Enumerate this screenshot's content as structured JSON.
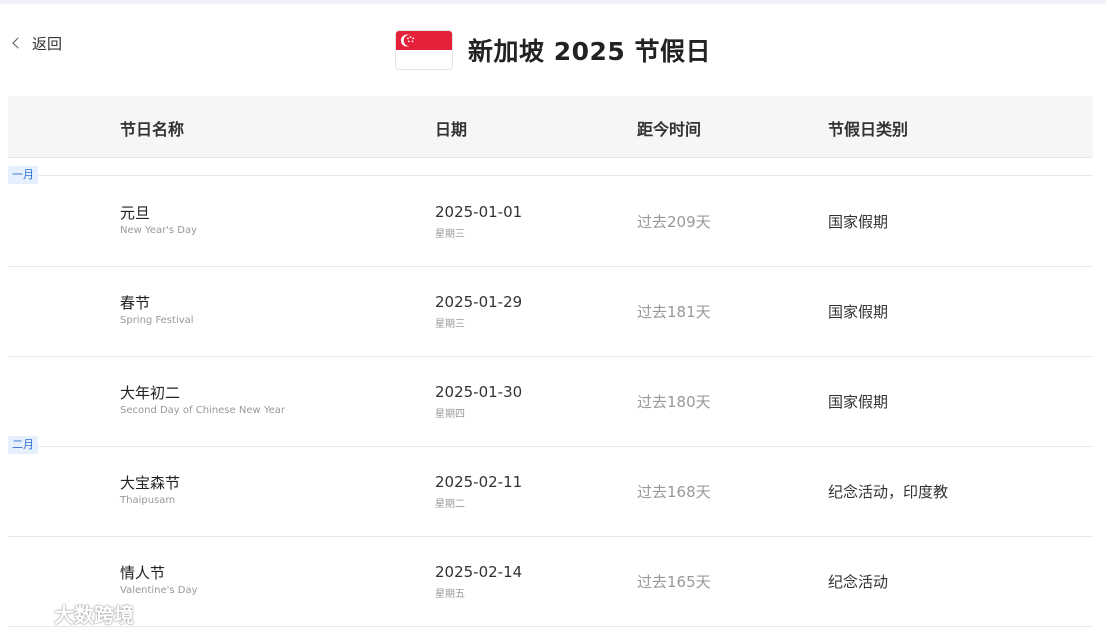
{
  "header": {
    "back_label": "返回",
    "title": "新加坡 2025 节假日",
    "flag_colors": {
      "red": "#e5213a",
      "white": "#ffffff"
    }
  },
  "table": {
    "columns": [
      "节日名称",
      "日期",
      "距今时间",
      "节假日类别"
    ],
    "months": [
      "一月",
      "二月"
    ],
    "rows": [
      {
        "name": "元旦",
        "name_en": "New Year's Day",
        "date": "2025-01-01",
        "weekday": "星期三",
        "ago": "过去209天",
        "type": "国家假期"
      },
      {
        "name": "春节",
        "name_en": "Spring Festival",
        "date": "2025-01-29",
        "weekday": "星期三",
        "ago": "过去181天",
        "type": "国家假期"
      },
      {
        "name": "大年初二",
        "name_en": "Second Day of Chinese New Year",
        "date": "2025-01-30",
        "weekday": "星期四",
        "ago": "过去180天",
        "type": "国家假期"
      },
      {
        "name": "大宝森节",
        "name_en": "Thaipusam",
        "date": "2025-02-11",
        "weekday": "星期二",
        "ago": "过去168天",
        "type": "纪念活动，印度教"
      },
      {
        "name": "情人节",
        "name_en": "Valentine's Day",
        "date": "2025-02-14",
        "weekday": "星期五",
        "ago": "过去165天",
        "type": "纪念活动"
      }
    ]
  },
  "watermark": {
    "text": "大数跨境",
    "logo_text": "K"
  },
  "colors": {
    "header_bg": "#f5f6f7",
    "month_tag_bg": "#e6f0fc",
    "month_tag_text": "#2f6fd6",
    "muted_text": "#999999"
  }
}
